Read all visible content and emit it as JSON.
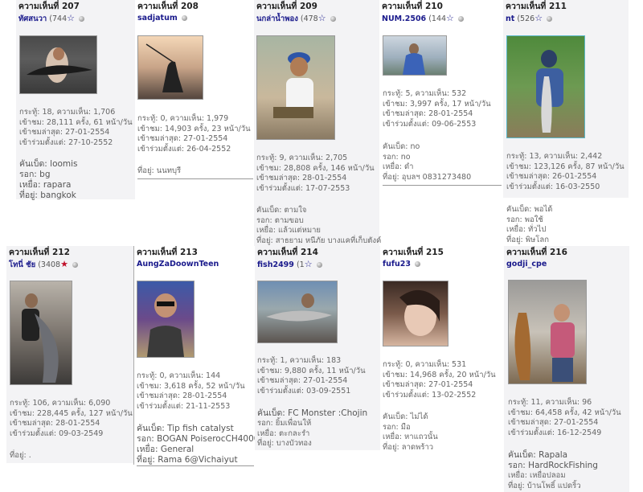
{
  "posts": [
    {
      "title": "ความเห็นที่ 207",
      "user": "ทัศสนวา",
      "posts": "(744",
      "star": "☆",
      "stats": [
        "กระทู้: 18, ความเห็น: 1,706",
        "เข้าชม: 28,111 ครั้ง, 61 หน้า/วัน",
        "เข้าชมล่าสุด: 27-01-2554",
        "เข้าร่วมตั้งแต่: 27-10-2552"
      ],
      "info": [
        "คันเบ็ด: loomis",
        "รอก: bg",
        "เหยื่อ: rapara",
        "ที่อยู่: bangkok"
      ]
    },
    {
      "title": "ความเห็นที่ 208",
      "user": "sadjatum",
      "posts": "",
      "star": "",
      "stats": [
        "กระทู้: 0, ความเห็น: 1,979",
        "เข้าชม: 14,903 ครั้ง, 23 หน้า/วัน",
        "เข้าชมล่าสุด: 27-01-2554",
        "เข้าร่วมตั้งแต่: 26-04-2552"
      ],
      "info": [
        "ที่อยู่: นนทบุรี"
      ]
    },
    {
      "title": "ความเห็นที่ 209",
      "user": "นกล่าน้ำพอง",
      "posts": "(478",
      "star": "☆",
      "stats": [
        "กระทู้: 9, ความเห็น: 2,705",
        "เข้าชม: 28,808 ครั้ง, 146 หน้า/วัน",
        "เข้าชมล่าสุด: 28-01-2554",
        "เข้าร่วมตั้งแต่: 17-07-2553"
      ],
      "info": [
        "คันเบ็ด: ตามใจ",
        "รอก: ตามขอบ",
        "เหยื่อ: แล้วแต่หมาย",
        "ที่อยู่: สาธยาม หนีภัย บางแคที่เก็บตังค์"
      ]
    },
    {
      "title": "ความเห็นที่ 210",
      "user": "NUM.2506",
      "posts": "(144",
      "star": "☆",
      "stats": [
        "กระทู้: 5, ความเห็น: 532",
        "เข้าชม: 3,997 ครั้ง, 17 หน้า/วัน",
        "เข้าชมล่าสุด: 28-01-2554",
        "เข้าร่วมตั้งแต่: 09-06-2553"
      ],
      "info": [
        "คันเบ็ด: no",
        "รอก: no",
        "เหยื่อ: ดำ",
        "ที่อยู่: อุบลฯ 0831273480"
      ]
    },
    {
      "title": "ความเห็นที่ 211",
      "user": "nt",
      "posts": "(526",
      "star": "☆",
      "stats": [
        "กระทู้: 13, ความเห็น: 2,442",
        "เข้าชม: 123,126 ครั้ง, 87 หน้า/วัน",
        "เข้าชมล่าสุด: 26-01-2554",
        "เข้าร่วมตั้งแต่: 16-03-2550"
      ],
      "info": [
        "คันเบ็ด: พอได้",
        "รอก: พอใช้",
        "เหยื่อ: ทั่วไป",
        "ที่อยู่: พิษโลก"
      ]
    },
    {
      "title": "ความเห็นที่ 212",
      "user": "โทนี่ ชัย",
      "posts": "(3408",
      "star": "★",
      "stats": [
        "กระทู้: 106, ความเห็น: 6,090",
        "เข้าชม: 228,445 ครั้ง, 127 หน้า/วัน",
        "เข้าชมล่าสุด: 28-01-2554",
        "เข้าร่วมตั้งแต่: 09-03-2549"
      ],
      "info": [
        "ที่อยู่: ."
      ]
    },
    {
      "title": "ความเห็นที่ 213",
      "user": "AungZaDoownTeen",
      "posts": "",
      "star": "",
      "stats": [
        "กระทู้: 0, ความเห็น: 144",
        "เข้าชม: 3,618 ครั้ง, 52 หน้า/วัน",
        "เข้าชมล่าสุด: 28-01-2554",
        "เข้าร่วมตั้งแต่: 21-11-2553"
      ],
      "info": [
        "คันเบ็ด: Tip fish catalyst",
        "รอก: BOGAN PoiserocCH4000",
        "เหยื่อ: General",
        "ที่อยู่: Rama 6@Vichaiyut"
      ]
    },
    {
      "title": "ความเห็นที่ 214",
      "user": "fish2499",
      "posts": "(1",
      "star": "☆",
      "stats": [
        "กระทู้: 1, ความเห็น: 183",
        "เข้าชม: 9,880 ครั้ง, 11 หน้า/วัน",
        "เข้าชมล่าสุด: 27-01-2554",
        "เข้าร่วมตั้งแต่: 03-09-2551"
      ],
      "info": [
        "คันเบ็ด: FC Monster :Chojin",
        "รอก: ยิ้มเพื่อนให้",
        "เหยื่อ: ตะกละรำ",
        "ที่อยู่: บางบัวทอง"
      ]
    },
    {
      "title": "ความเห็นที่ 215",
      "user": "fufu23",
      "posts": "",
      "star": "",
      "stats": [
        "กระทู้: 0, ความเห็น: 531",
        "เข้าชม: 14,968 ครั้ง, 20 หน้า/วัน",
        "เข้าชมล่าสุด: 27-01-2554",
        "เข้าร่วมตั้งแต่: 13-02-2552"
      ],
      "info": [
        "คันเบ็ด: ไม่ได้",
        "รอก: มือ",
        "เหยื่อ: หาแถวนั้น",
        "ที่อยู่: ลาดพร้าว"
      ]
    },
    {
      "title": "ความเห็นที่ 216",
      "user": "godji_cpe",
      "posts": "",
      "star": "",
      "stats": [
        "กระทู้: 11, ความเห็น: 96",
        "เข้าชม: 64,458 ครั้ง, 42 หน้า/วัน",
        "เข้าชมล่าสุด: 27-01-2554",
        "เข้าร่วมตั้งแต่: 16-12-2549"
      ],
      "info": [
        "คันเบ็ด: Rapala",
        "รอก: HardRockFishing",
        "เหยื่อ: เหยื่อปลอม",
        "ที่อยู่: บ้านโพธิ์ แปดริ้ว"
      ]
    }
  ]
}
